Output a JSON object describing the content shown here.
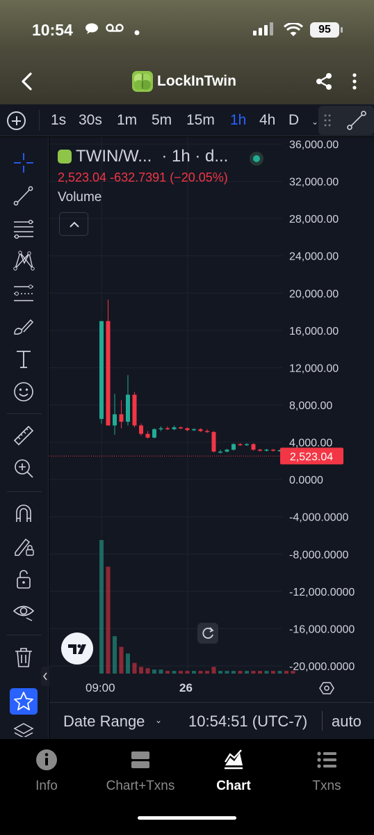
{
  "status_bar": {
    "time": "10:54",
    "battery": "95"
  },
  "header": {
    "title": "LockInTwin"
  },
  "intervals": {
    "items": [
      "1s",
      "30s",
      "1m",
      "5m",
      "15m",
      "1h",
      "4h",
      "D"
    ],
    "active": "1h"
  },
  "legend": {
    "symbol": "TWIN/W...",
    "interval_text": "· 1h · d...",
    "last_price": "2,523.04",
    "change": "-632.7391",
    "change_pct": "(−20.05%)",
    "volume_label": "Volume"
  },
  "price_axis": {
    "labels": [
      "36,000.00",
      "32,000.00",
      "28,000.00",
      "24,000.00",
      "20,000.00",
      "16,000.00",
      "12,000.00",
      "8,000.00",
      "4,000.00",
      "0.0000",
      "-4,000.0000",
      "-8,000.0000",
      "-12,000.0000",
      "-16,000.0000",
      "-20,000.0000"
    ],
    "current_price_tag": "2,523.04"
  },
  "time_axis": {
    "labels": [
      "09:00",
      "26"
    ]
  },
  "range_bar": {
    "date_range_label": "Date Range",
    "clock": "10:54:51 (UTC-7)",
    "scale_mode": "auto"
  },
  "bottom_nav": {
    "items": [
      {
        "label": "Info",
        "icon": "info-icon"
      },
      {
        "label": "Chart+Txns",
        "icon": "chart-txns-icon"
      },
      {
        "label": "Chart",
        "icon": "chart-icon"
      },
      {
        "label": "Txns",
        "icon": "list-icon"
      }
    ],
    "active": "Chart"
  },
  "colors": {
    "up": "#22ab94",
    "down": "#f23645",
    "accent": "#2962ff",
    "background": "#131722"
  },
  "chart_data": {
    "type": "candlestick",
    "ylim": [
      -20000,
      36000
    ],
    "candles": [
      {
        "o": 6500,
        "h": 17000,
        "l": 6000,
        "c": 17000
      },
      {
        "o": 17000,
        "h": 19300,
        "l": 5800,
        "c": 5800
      },
      {
        "o": 5800,
        "h": 9200,
        "l": 4800,
        "c": 7000
      },
      {
        "o": 7000,
        "h": 8500,
        "l": 5500,
        "c": 6200
      },
      {
        "o": 6200,
        "h": 11200,
        "l": 5800,
        "c": 9100
      },
      {
        "o": 9100,
        "h": 9400,
        "l": 5600,
        "c": 5800
      },
      {
        "o": 5800,
        "h": 6000,
        "l": 4700,
        "c": 4900
      },
      {
        "o": 4900,
        "h": 5200,
        "l": 4400,
        "c": 4500
      },
      {
        "o": 4500,
        "h": 5500,
        "l": 4400,
        "c": 5400
      },
      {
        "o": 5400,
        "h": 5700,
        "l": 5200,
        "c": 5500
      },
      {
        "o": 5500,
        "h": 5700,
        "l": 5300,
        "c": 5400
      },
      {
        "o": 5400,
        "h": 5800,
        "l": 5300,
        "c": 5600
      },
      {
        "o": 5600,
        "h": 5700,
        "l": 5400,
        "c": 5500
      },
      {
        "o": 5500,
        "h": 5600,
        "l": 5200,
        "c": 5300
      },
      {
        "o": 5300,
        "h": 5500,
        "l": 5200,
        "c": 5400
      },
      {
        "o": 5400,
        "h": 5500,
        "l": 5100,
        "c": 5200
      },
      {
        "o": 5200,
        "h": 5400,
        "l": 5000,
        "c": 5100
      },
      {
        "o": 5100,
        "h": 5200,
        "l": 2900,
        "c": 3000
      },
      {
        "o": 3000,
        "h": 3200,
        "l": 2800,
        "c": 3000
      },
      {
        "o": 3000,
        "h": 3300,
        "l": 2900,
        "c": 3200
      },
      {
        "o": 3200,
        "h": 3900,
        "l": 3100,
        "c": 3800
      },
      {
        "o": 3800,
        "h": 3900,
        "l": 3600,
        "c": 3700
      },
      {
        "o": 3700,
        "h": 3900,
        "l": 3600,
        "c": 3800
      },
      {
        "o": 3800,
        "h": 3900,
        "l": 3100,
        "c": 3200
      },
      {
        "o": 3200,
        "h": 3300,
        "l": 3000,
        "c": 3100
      },
      {
        "o": 3100,
        "h": 3300,
        "l": 3000,
        "c": 3200
      },
      {
        "o": 3200,
        "h": 3300,
        "l": 3000,
        "c": 3100
      },
      {
        "o": 3100,
        "h": 3200,
        "l": 3000,
        "c": 3150
      },
      {
        "o": 3150,
        "h": 3250,
        "l": 3000,
        "c": 3100
      },
      {
        "o": 3100,
        "h": 3200,
        "l": 2400,
        "c": 2523.04
      }
    ],
    "volume_relative": [
      1.0,
      0.8,
      0.28,
      0.2,
      0.15,
      0.08,
      0.05,
      0.04,
      0.03,
      0.03,
      0.02,
      0.02,
      0.02,
      0.02,
      0.02,
      0.02,
      0.02,
      0.05,
      0.02,
      0.02,
      0.02,
      0.02,
      0.02,
      0.02,
      0.02,
      0.02,
      0.02,
      0.02,
      0.02,
      0.02
    ]
  }
}
